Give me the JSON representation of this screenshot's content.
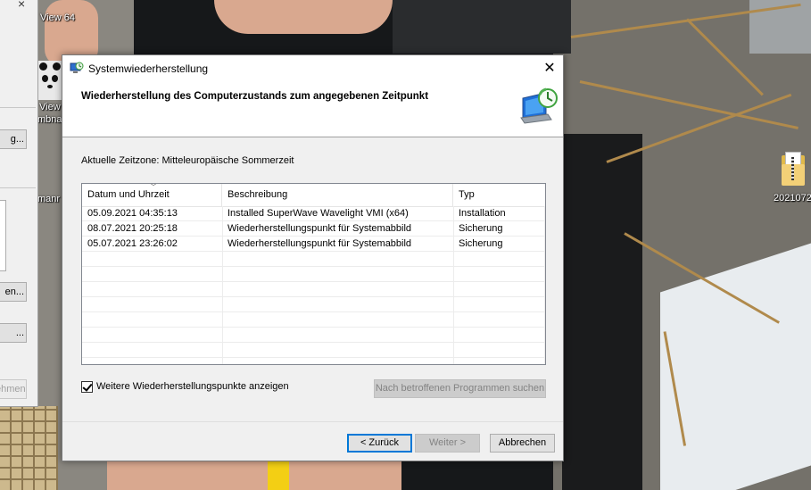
{
  "desktop": {
    "top_label": "View 64",
    "side_label_1": "View",
    "side_label_2": "mbna",
    "side_label_3": "manr",
    "file_icon_label": "2021072"
  },
  "left_window": {
    "buttons": [
      "g...",
      "en...",
      "...",
      "ehmen"
    ]
  },
  "dialog": {
    "title": "Systemwiederherstellung",
    "close_glyph": "✕",
    "heading": "Wiederherstellung des Computerzustands zum angegebenen Zeitpunkt",
    "timezone": "Aktuelle Zeitzone: Mitteleuropäische Sommerzeit",
    "columns": [
      "Datum und Uhrzeit",
      "Beschreibung",
      "Typ"
    ],
    "rows": [
      {
        "date": "05.09.2021 04:35:13",
        "desc": "Installed SuperWave Wavelight VMI (x64)",
        "type": "Installation"
      },
      {
        "date": "08.07.2021 20:25:18",
        "desc": "Wiederherstellungspunkt für Systemabbild",
        "type": "Sicherung"
      },
      {
        "date": "05.07.2021 23:26:02",
        "desc": "Wiederherstellungspunkt für Systemabbild",
        "type": "Sicherung"
      }
    ],
    "checkbox_label": "Weitere Wiederherstellungspunkte anzeigen",
    "checkbox_checked": true,
    "scan_button": "Nach betroffenen Programmen suchen",
    "back_button": "< Zurück",
    "next_button": "Weiter >",
    "cancel_button": "Abbrechen"
  }
}
